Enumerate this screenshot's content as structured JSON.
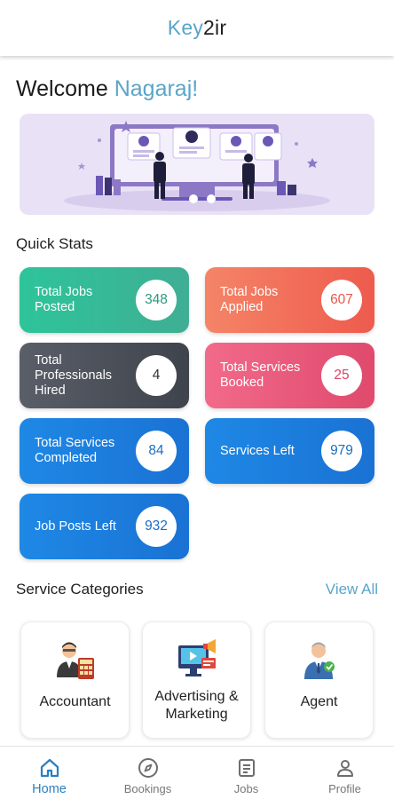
{
  "app": {
    "brand_part1": "Key",
    "brand_part2": "2ir"
  },
  "welcome": {
    "greeting": "Welcome",
    "name": "Nagaraj!"
  },
  "quick_stats": {
    "title": "Quick Stats",
    "items": [
      {
        "label": "Total Jobs Posted",
        "value": "348",
        "color": "#2ec49a"
      },
      {
        "label": "Total Jobs Applied",
        "value": "607",
        "color": "#f26f5a"
      },
      {
        "label": "Total Professionals Hired",
        "value": "4",
        "color": "#4a4e57"
      },
      {
        "label": "Total Services Booked",
        "value": "25",
        "color": "#e9577a"
      },
      {
        "label": "Total Services Completed",
        "value": "84",
        "color": "#1e80dd"
      },
      {
        "label": "Services Left",
        "value": "979",
        "color": "#1e80dd"
      },
      {
        "label": "Job Posts Left",
        "value": "932",
        "color": "#1e80dd"
      }
    ]
  },
  "service_categories": {
    "title": "Service Categories",
    "view_all": "View All",
    "items": [
      {
        "label": "Accountant",
        "icon": "accountant-icon"
      },
      {
        "label": "Advertising & Marketing",
        "icon": "advertising-icon"
      },
      {
        "label": "Agent",
        "icon": "agent-icon"
      }
    ]
  },
  "bottom_nav": [
    {
      "label": "Home",
      "icon": "home-icon",
      "active": true
    },
    {
      "label": "Bookings",
      "icon": "compass-icon",
      "active": false
    },
    {
      "label": "Jobs",
      "icon": "document-icon",
      "active": false
    },
    {
      "label": "Profile",
      "icon": "person-icon",
      "active": false
    }
  ],
  "colors": {
    "accent": "#5aa5c9",
    "nav_active": "#2a7fc1"
  }
}
